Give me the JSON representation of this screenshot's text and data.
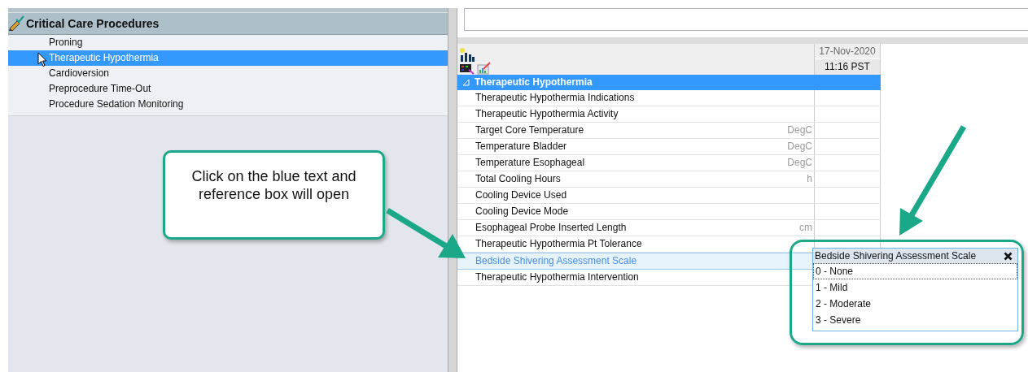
{
  "sidebar": {
    "section_title": "Critical Care Procedures",
    "items": [
      {
        "label": "Proning",
        "selected": false
      },
      {
        "label": "Therapeutic Hypothermia",
        "selected": true
      },
      {
        "label": "Cardioversion",
        "selected": false
      },
      {
        "label": "Preprocedure Time-Out",
        "selected": false
      },
      {
        "label": "Procedure Sedation Monitoring",
        "selected": false
      }
    ]
  },
  "flowsheet": {
    "date": "17-Nov-2020",
    "time": "11:16 PST",
    "group": {
      "label": "Therapeutic Hypothermia",
      "expanded": true
    },
    "rows": [
      {
        "label": "Therapeutic Hypothermia Indications",
        "kind": "plain"
      },
      {
        "label": "Therapeutic Hypothermia Activity",
        "kind": "plain"
      },
      {
        "label": "Target Core Temperature",
        "unit": "DegC",
        "kind": "plain"
      },
      {
        "label": "Temperature Bladder",
        "unit": "DegC",
        "kind": "plain"
      },
      {
        "label": "Temperature Esophageal",
        "unit": "DegC",
        "kind": "plain"
      },
      {
        "label": "Total Cooling Hours",
        "unit": "h",
        "kind": "plain"
      },
      {
        "label": "Cooling Device Used",
        "kind": "plain"
      },
      {
        "label": "Cooling Device Mode",
        "kind": "plain"
      },
      {
        "label": "Esophageal Probe Inserted Length",
        "unit": "cm",
        "kind": "plain"
      },
      {
        "label": "Therapeutic Hypothermia Pt Tolerance",
        "kind": "plain"
      },
      {
        "label": "Bedside Shivering Assessment Scale",
        "kind": "link"
      },
      {
        "label": "Therapeutic Hypothermia Intervention",
        "kind": "plain"
      }
    ]
  },
  "popup": {
    "title": "Bedside Shivering Assessment Scale",
    "options": [
      {
        "label": "0 - None",
        "focused": true
      },
      {
        "label": "1 - Mild",
        "focused": false
      },
      {
        "label": "2 - Moderate",
        "focused": false
      },
      {
        "label": "3 - Severe",
        "focused": false
      }
    ]
  },
  "callout": {
    "text": "Click on the blue text and reference box will open"
  }
}
